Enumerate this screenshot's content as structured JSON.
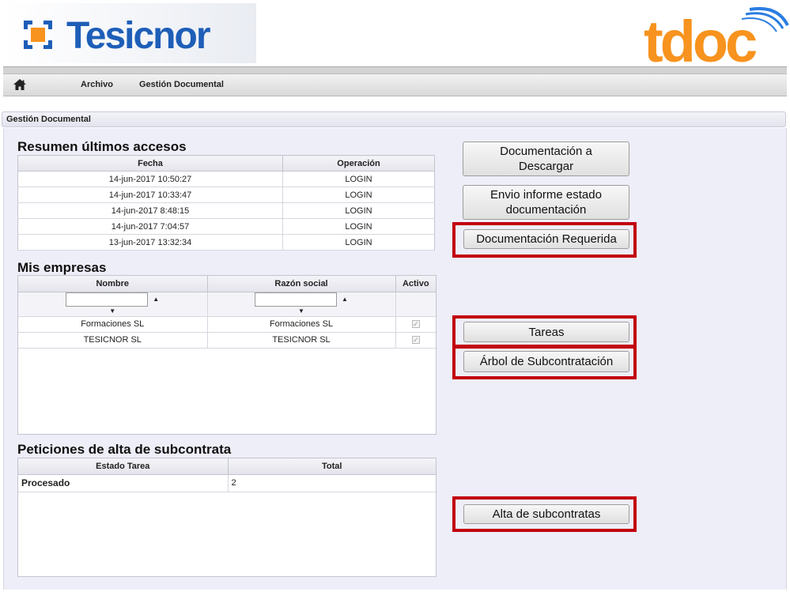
{
  "header": {
    "brand_left": "Tesicnor",
    "brand_right": "tdoc"
  },
  "menu": {
    "home_icon": "home-icon",
    "items": [
      "Archivo",
      "Gestión Documental"
    ]
  },
  "section_title": "Gestión Documental",
  "accesos": {
    "title": "Resumen últimos accesos",
    "columns": [
      "Fecha",
      "Operación"
    ],
    "rows": [
      [
        "14-jun-2017 10:50:27",
        "LOGIN"
      ],
      [
        "14-jun-2017 10:33:47",
        "LOGIN"
      ],
      [
        "14-jun-2017 8:48:15",
        "LOGIN"
      ],
      [
        "14-jun-2017 7:04:57",
        "LOGIN"
      ],
      [
        "13-jun-2017 13:32:34",
        "LOGIN"
      ]
    ]
  },
  "empresas": {
    "title": "Mis empresas",
    "columns": [
      "Nombre",
      "Razón social",
      "Activo"
    ],
    "filter_nombre": "",
    "filter_razon": "",
    "rows": [
      [
        "Formaciones SL",
        "Formaciones SL",
        "✓"
      ],
      [
        "TESICNOR SL",
        "TESICNOR SL",
        "✓"
      ]
    ]
  },
  "peticiones": {
    "title": "Peticiones de alta de subcontrata",
    "columns": [
      "Estado Tarea",
      "Total"
    ],
    "rows": [
      [
        "Procesado",
        "2"
      ]
    ]
  },
  "buttons": {
    "doc_descargar_line1": "Documentación a",
    "doc_descargar_line2": "Descargar",
    "envio_informe_line1": "Envio informe estado",
    "envio_informe_line2": "documentación",
    "doc_requerida": "Documentación Requerida",
    "tareas": "Tareas",
    "arbol": "Árbol de Subcontratación",
    "alta_subcontratas": "Alta de subcontratas"
  },
  "colors": {
    "highlight": "#c2000f",
    "brand_blue": "#1e5eb8",
    "brand_orange": "#f7931e",
    "status_green": "#1a8a1a"
  }
}
